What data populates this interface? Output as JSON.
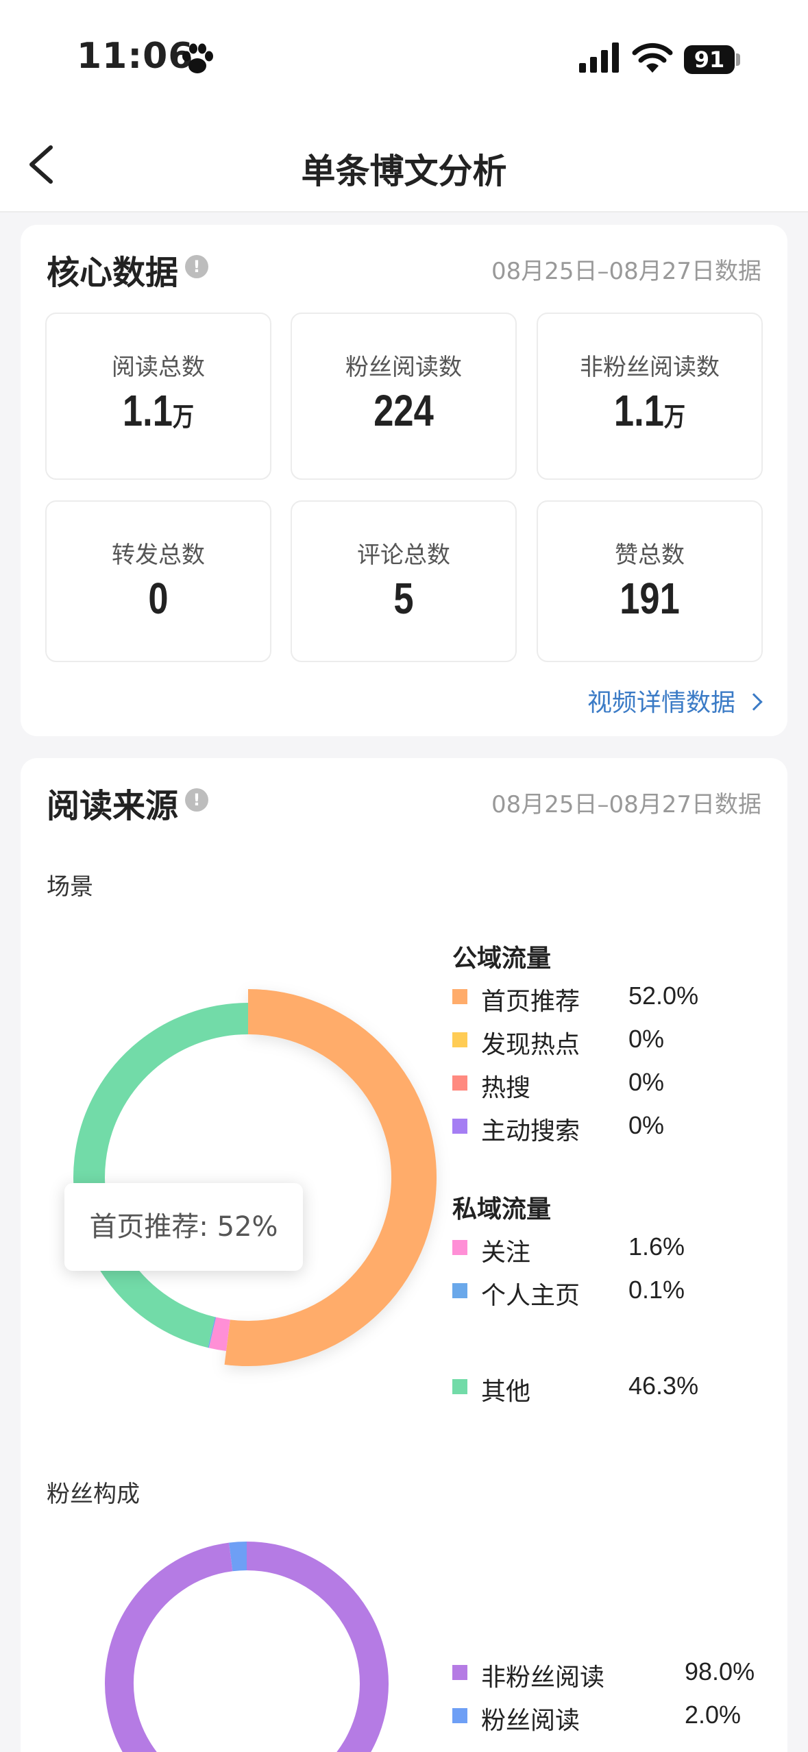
{
  "status_bar": {
    "time": "11:06",
    "battery": "91"
  },
  "nav": {
    "title": "单条博文分析"
  },
  "core": {
    "title": "核心数据",
    "info": "!",
    "date_range": "08月25日–08月27日数据",
    "stats": [
      {
        "label": "阅读总数",
        "value": "1.1",
        "unit": "万"
      },
      {
        "label": "粉丝阅读数",
        "value": "224",
        "unit": ""
      },
      {
        "label": "非粉丝阅读数",
        "value": "1.1",
        "unit": "万"
      },
      {
        "label": "转发总数",
        "value": "0",
        "unit": ""
      },
      {
        "label": "评论总数",
        "value": "5",
        "unit": ""
      },
      {
        "label": "赞总数",
        "value": "191",
        "unit": ""
      }
    ],
    "detail_link": "视频详情数据"
  },
  "source": {
    "title": "阅读来源",
    "info": "!",
    "date_range": "08月25日–08月27日数据",
    "scene_label": "场景",
    "public_group": "公域流量",
    "private_group": "私域流量",
    "tooltip": "首页推荐: 52%",
    "fans_label": "粉丝构成"
  },
  "chart_data": [
    {
      "type": "pie",
      "title": "场景",
      "donut": true,
      "slices": [
        {
          "name": "首页推荐",
          "value": 52.0,
          "label": "52.0%",
          "color": "#ffac6b",
          "group": "公域流量"
        },
        {
          "name": "发现热点",
          "value": 0,
          "label": "0%",
          "color": "#ffcc55",
          "group": "公域流量"
        },
        {
          "name": "热搜",
          "value": 0,
          "label": "0%",
          "color": "#ff8a80",
          "group": "公域流量"
        },
        {
          "name": "主动搜索",
          "value": 0,
          "label": "0%",
          "color": "#a57ef3",
          "group": "公域流量"
        },
        {
          "name": "关注",
          "value": 1.6,
          "label": "1.6%",
          "color": "#ff8fd6",
          "group": "私域流量"
        },
        {
          "name": "个人主页",
          "value": 0.1,
          "label": "0.1%",
          "color": "#6aa8ea",
          "group": "私域流量"
        },
        {
          "name": "其他",
          "value": 46.3,
          "label": "46.3%",
          "color": "#72dba8",
          "group": ""
        }
      ],
      "tooltip": "首页推荐: 52%"
    },
    {
      "type": "pie",
      "title": "粉丝构成",
      "donut": true,
      "slices": [
        {
          "name": "非粉丝阅读",
          "value": 98.0,
          "label": "98.0%",
          "color": "#b57be4"
        },
        {
          "name": "粉丝阅读",
          "value": 2.0,
          "label": "2.0%",
          "color": "#6e9ff5"
        }
      ]
    }
  ]
}
